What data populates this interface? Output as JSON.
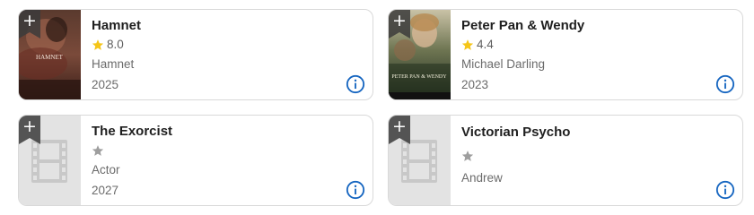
{
  "colors": {
    "star_gold": "#f5c518",
    "star_empty": "#9e9e9e",
    "info_blue": "#1565c0",
    "ribbon": "#3b3b3b"
  },
  "cards": [
    {
      "title": "Hamnet",
      "rating": "8.0",
      "has_rating": true,
      "subtitle": "Hamnet",
      "year": "2025",
      "poster_text": "HAMNET"
    },
    {
      "title": "Peter Pan & Wendy",
      "rating": "4.4",
      "has_rating": true,
      "subtitle": "Michael Darling",
      "year": "2023",
      "poster_text": "PETER PAN & WENDY"
    },
    {
      "title": "The Exorcist",
      "rating": "",
      "has_rating": false,
      "subtitle": "Actor",
      "year": "2027"
    },
    {
      "title": "Victorian Psycho",
      "rating": "",
      "has_rating": false,
      "subtitle": "Andrew",
      "year": ""
    }
  ],
  "icons": {
    "add": "+",
    "star": "star-icon",
    "info": "info-icon",
    "placeholder": "film-icon"
  }
}
